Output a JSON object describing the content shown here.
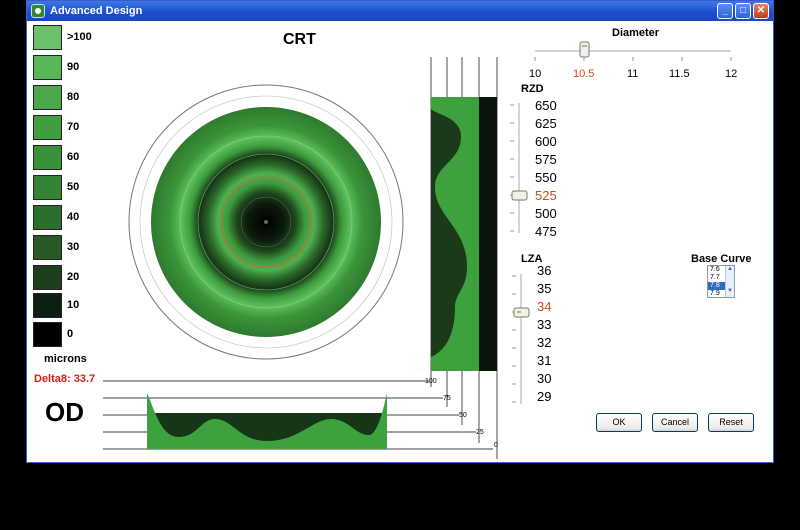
{
  "window": {
    "title": "Advanced Design",
    "min": "_",
    "max": "□",
    "close": "✕"
  },
  "scale": {
    "items": [
      {
        "label": ">100",
        "color": "#6cc16c"
      },
      {
        "label": "90",
        "color": "#58b558"
      },
      {
        "label": "80",
        "color": "#4aa84a"
      },
      {
        "label": "70",
        "color": "#3f9e3f"
      },
      {
        "label": "60",
        "color": "#3a903a"
      },
      {
        "label": "50",
        "color": "#348234"
      },
      {
        "label": "40",
        "color": "#2c6f2c"
      },
      {
        "label": "30",
        "color": "#275a27"
      },
      {
        "label": "20",
        "color": "#1e3f1e"
      },
      {
        "label": "10",
        "color": "#0f1f0f"
      },
      {
        "label": "0",
        "color": "#000000"
      }
    ],
    "unit": "microns"
  },
  "delta_label": "Delta8: 33.7",
  "eye_label": "OD",
  "map_title": "CRT",
  "horizontal_profile_ticks": [
    "100",
    "75",
    "50",
    "25",
    "0"
  ],
  "diameter": {
    "label": "Diameter",
    "ticks": [
      "10",
      "10.5",
      "11",
      "11.5",
      "12"
    ],
    "selected": "10.5",
    "value": 10.5
  },
  "rzd": {
    "label": "RZD",
    "ticks": [
      "650",
      "625",
      "600",
      "575",
      "550",
      "525",
      "500",
      "475"
    ],
    "selected": "525",
    "value": 525
  },
  "lza": {
    "label": "LZA",
    "ticks": [
      "36",
      "35",
      "34",
      "33",
      "32",
      "31",
      "30",
      "29"
    ],
    "selected": "34",
    "value": 34
  },
  "base_curve": {
    "label": "Base Curve",
    "options": [
      "7.6",
      "7.7",
      "7.8",
      "7.9"
    ],
    "selected": "7.8"
  },
  "buttons": {
    "ok": "OK",
    "cancel": "Cancel",
    "reset": "Reset"
  },
  "colors": {
    "accent": "#d04a14",
    "delta": "#d1221a",
    "titlebar": "#1c4fcd"
  }
}
